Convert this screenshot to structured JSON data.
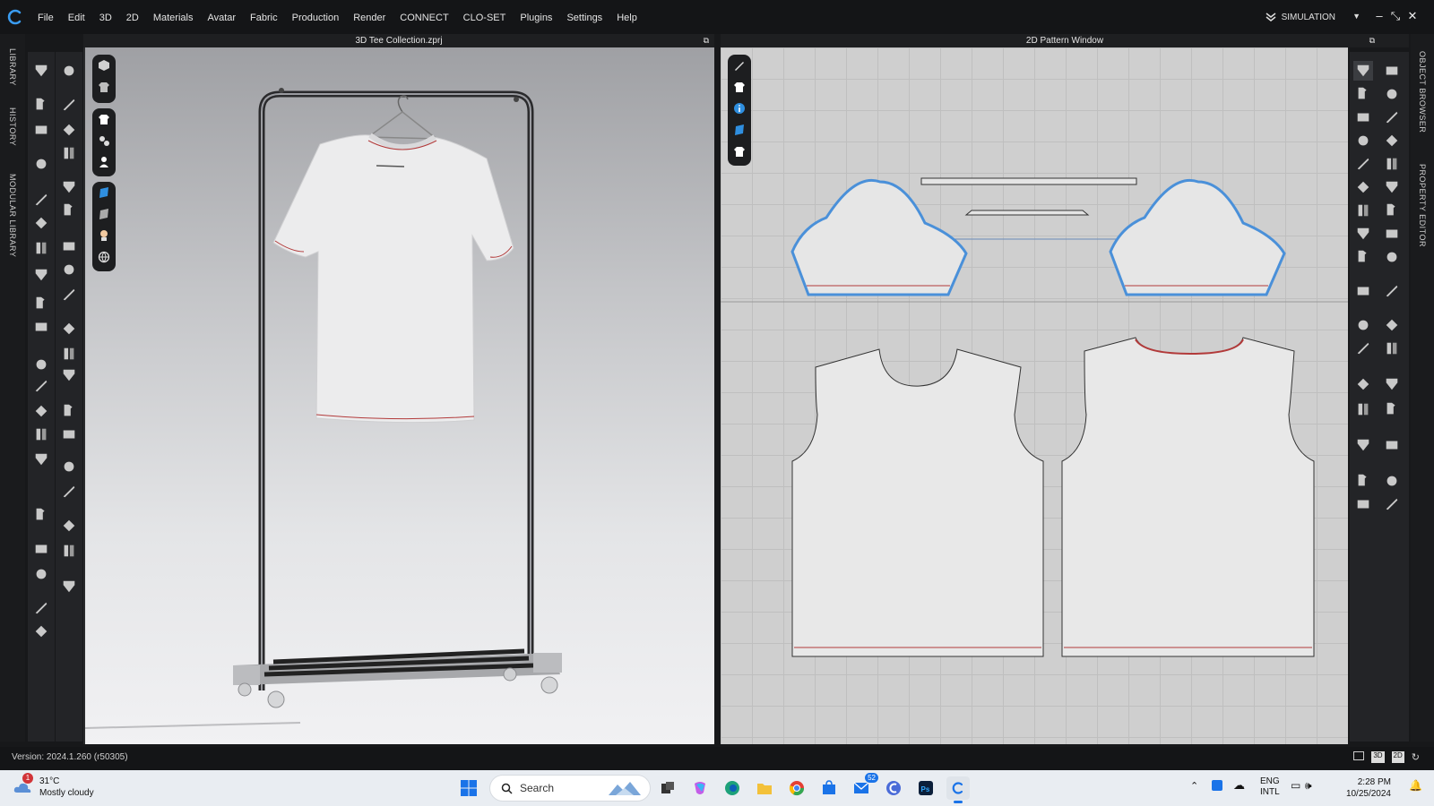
{
  "app": {
    "logo_icon": "clo-logo-icon",
    "menu": [
      "File",
      "Edit",
      "3D",
      "2D",
      "Materials",
      "Avatar",
      "Fabric",
      "Production",
      "Render",
      "CONNECT",
      "CLO-SET",
      "Plugins",
      "Settings",
      "Help"
    ],
    "mode_label": "SIMULATION",
    "window_controls": [
      "minimize",
      "restore",
      "close"
    ]
  },
  "left_tabs": [
    "LIBRARY",
    "HISTORY",
    "MODULAR LIBRARY"
  ],
  "right_tabs": [
    "OBJECT BROWSER",
    "PROPERTY EDITOR"
  ],
  "panels": {
    "viewport_3d_title": "3D Tee Collection.zprj",
    "viewport_2d_title": "2D Pattern Window"
  },
  "status": {
    "version": "Version: 2024.1.260 (r50305)",
    "view_buttons": [
      "split-view",
      "3D",
      "2D",
      "refresh"
    ]
  },
  "taskbar": {
    "weather_temp": "31°C",
    "weather_desc": "Mostly cloudy",
    "weather_badge": "1",
    "search_placeholder": "Search",
    "mail_badge": "52",
    "lang_top": "ENG",
    "lang_bottom": "INTL",
    "time": "2:28 PM",
    "date": "10/25/2024"
  },
  "colors": {
    "accent": "#2f8fe0",
    "seam_red": "#b23a3a",
    "sleeve_outline": "#4a90d9"
  }
}
